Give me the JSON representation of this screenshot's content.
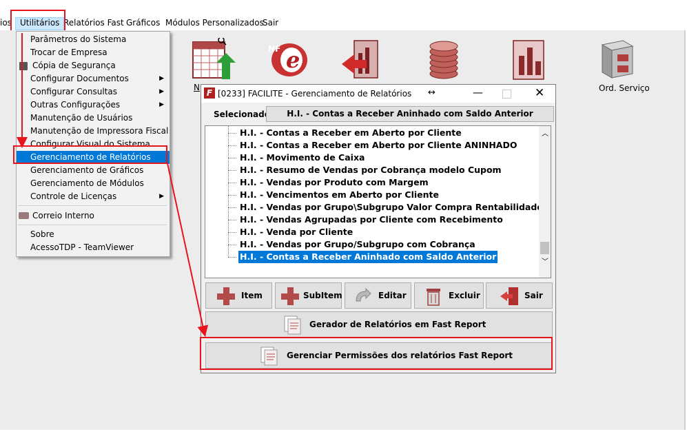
{
  "menubar": {
    "items": [
      "ios",
      "Utilitários",
      "Relatórios Fast",
      "Gráficos",
      "Módulos Personalizados",
      "Sair"
    ]
  },
  "toolbar": {
    "ord_servico_label": "Ord. Serviço",
    "cut_label": "N"
  },
  "dropdown": {
    "items": [
      {
        "label": "Parâmetros do Sistema"
      },
      {
        "label": "Trocar de Empresa"
      },
      {
        "label": "Cópia de Segurança",
        "icon": "floppy-icon"
      },
      {
        "label": "Configurar Documentos",
        "submenu": true
      },
      {
        "label": "Configurar Consultas",
        "submenu": true
      },
      {
        "label": "Outras Configurações",
        "submenu": true
      },
      {
        "label": "Manutenção de Usuários"
      },
      {
        "label": "Manutenção de Impressora Fiscal"
      },
      {
        "label": "Configurar Visual do Sistema"
      },
      {
        "label": "Gerenciamento de Relatórios",
        "selected": true
      },
      {
        "label": "Gerenciamento de Gráficos"
      },
      {
        "label": "Gerenciamento de Módulos"
      },
      {
        "label": "Controle de Licenças",
        "submenu": true
      },
      {
        "label": "Correio Interno",
        "icon": "mail-icon"
      },
      {
        "label": "Sobre"
      },
      {
        "label": "AcessoTDP - TeamViewer"
      }
    ]
  },
  "dialog": {
    "title": "[0233] FACILITE - Gerenciamento de Relatórios",
    "selected_label": "Selecionado",
    "selected_value": "H.I. - Contas a Receber Aninhado com Saldo Anterior",
    "tree": [
      "H.I. - Contas a Receber em Aberto por Cliente",
      "H.I. - Contas a Receber em Aberto por Cliente ANINHADO",
      "H.I. - Movimento de Caixa",
      "H.I. - Resumo de Vendas por Cobrança modelo Cupom",
      "H.I. - Vendas por Produto com Margem",
      "H.I. - Vencimentos em Aberto por Cliente",
      "H.I. - Vendas por Grupo\\Subgrupo Valor Compra Rentabilidade",
      "H.I. - Vendas Agrupadas por Cliente com Recebimento",
      "H.I. - Venda por Cliente",
      "H.I. - Vendas por Grupo/Subgrupo com Cobrança",
      "H.I. - Contas a Receber Aninhado com Saldo Anterior"
    ],
    "buttons": {
      "item": "Item",
      "subitem": "SubItem",
      "editar": "Editar",
      "excluir": "Excluir",
      "sair": "Sair"
    },
    "gerador": "Gerador de Relatórios em Fast Report",
    "gerenciar": "Gerenciar Permissões dos relatórios Fast Report"
  }
}
